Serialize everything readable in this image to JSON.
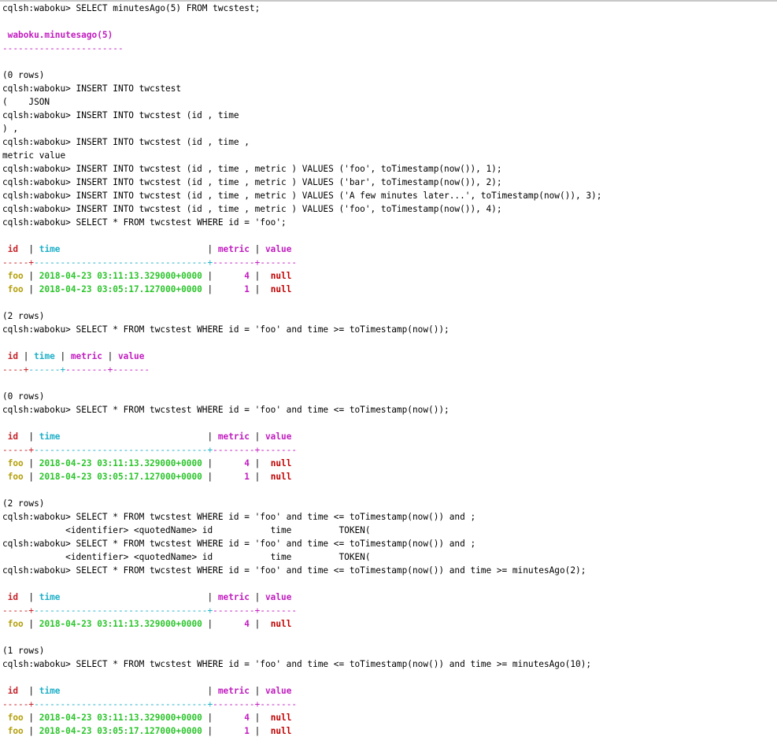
{
  "prompt": "cqlsh:waboku>",
  "lines": [
    {
      "t": "cmd",
      "text": "SELECT minutesAgo(5) FROM twcstest;"
    },
    {
      "t": "blank"
    },
    {
      "t": "header1",
      "text": " waboku.minutesago(5)"
    },
    {
      "t": "sep1",
      "text": "-----------------------"
    },
    {
      "t": "blank"
    },
    {
      "t": "plain",
      "text": "(0 rows)"
    },
    {
      "t": "cmd",
      "text": "INSERT INTO twcstest"
    },
    {
      "t": "plain",
      "text": "(    JSON"
    },
    {
      "t": "cmd",
      "text": "INSERT INTO twcstest (id , time"
    },
    {
      "t": "plain",
      "text": ") ,"
    },
    {
      "t": "cmd",
      "text": "INSERT INTO twcstest (id , time ,"
    },
    {
      "t": "plain",
      "text": "metric value"
    },
    {
      "t": "cmd",
      "text": "INSERT INTO twcstest (id , time , metric ) VALUES ('foo', toTimestamp(now()), 1);"
    },
    {
      "t": "cmd",
      "text": "INSERT INTO twcstest (id , time , metric ) VALUES ('bar', toTimestamp(now()), 2);"
    },
    {
      "t": "cmd",
      "text": "INSERT INTO twcstest (id , time , metric ) VALUES ('A few minutes later...', toTimestamp(now()), 3);"
    },
    {
      "t": "cmd",
      "text": "INSERT INTO twcstest (id , time , metric ) VALUES ('foo', toTimestamp(now()), 4);"
    },
    {
      "t": "cmd",
      "text": "SELECT * FROM twcstest WHERE id = 'foo';"
    },
    {
      "t": "blank"
    },
    {
      "t": "theader",
      "wide": true
    },
    {
      "t": "tsep",
      "wide": true
    },
    {
      "t": "row",
      "ts": "2018-04-23 03:11:13.329000+0000",
      "metric": "4"
    },
    {
      "t": "row",
      "ts": "2018-04-23 03:05:17.127000+0000",
      "metric": "1"
    },
    {
      "t": "blank"
    },
    {
      "t": "plain",
      "text": "(2 rows)"
    },
    {
      "t": "cmd",
      "text": "SELECT * FROM twcstest WHERE id = 'foo' and time >= toTimestamp(now());"
    },
    {
      "t": "blank"
    },
    {
      "t": "theader",
      "wide": false
    },
    {
      "t": "tsep",
      "wide": false
    },
    {
      "t": "blank"
    },
    {
      "t": "plain",
      "text": "(0 rows)"
    },
    {
      "t": "cmd",
      "text": "SELECT * FROM twcstest WHERE id = 'foo' and time <= toTimestamp(now());"
    },
    {
      "t": "blank"
    },
    {
      "t": "theader",
      "wide": true
    },
    {
      "t": "tsep",
      "wide": true
    },
    {
      "t": "row",
      "ts": "2018-04-23 03:11:13.329000+0000",
      "metric": "4"
    },
    {
      "t": "row",
      "ts": "2018-04-23 03:05:17.127000+0000",
      "metric": "1"
    },
    {
      "t": "blank"
    },
    {
      "t": "plain",
      "text": "(2 rows)"
    },
    {
      "t": "cmd",
      "text": "SELECT * FROM twcstest WHERE id = 'foo' and time <= toTimestamp(now()) and ;"
    },
    {
      "t": "plain",
      "text": "            <identifier> <quotedName> id           time         TOKEN("
    },
    {
      "t": "cmd",
      "text": "SELECT * FROM twcstest WHERE id = 'foo' and time <= toTimestamp(now()) and ;"
    },
    {
      "t": "plain",
      "text": "            <identifier> <quotedName> id           time         TOKEN("
    },
    {
      "t": "cmd",
      "text": "SELECT * FROM twcstest WHERE id = 'foo' and time <= toTimestamp(now()) and time >= minutesAgo(2);"
    },
    {
      "t": "blank"
    },
    {
      "t": "theader",
      "wide": true
    },
    {
      "t": "tsep",
      "wide": true
    },
    {
      "t": "row",
      "ts": "2018-04-23 03:11:13.329000+0000",
      "metric": "4"
    },
    {
      "t": "blank"
    },
    {
      "t": "plain",
      "text": "(1 rows)"
    },
    {
      "t": "cmd",
      "text": "SELECT * FROM twcstest WHERE id = 'foo' and time <= toTimestamp(now()) and time >= minutesAgo(10);"
    },
    {
      "t": "blank"
    },
    {
      "t": "theader",
      "wide": true
    },
    {
      "t": "tsep",
      "wide": true
    },
    {
      "t": "row",
      "ts": "2018-04-23 03:11:13.329000+0000",
      "metric": "4"
    },
    {
      "t": "row",
      "ts": "2018-04-23 03:05:17.127000+0000",
      "metric": "1"
    }
  ],
  "columns": {
    "id": "id",
    "time": "time",
    "metric": "metric",
    "value": "value"
  },
  "row_id": "foo",
  "null_text": "null",
  "colors": {
    "id_header": "#c7242a",
    "time_header": "#1fb0c8",
    "metric_header": "#c21cc0",
    "id_value": "#b5a00c",
    "time_value": "#2cc52c",
    "null_value": "#c00000"
  }
}
